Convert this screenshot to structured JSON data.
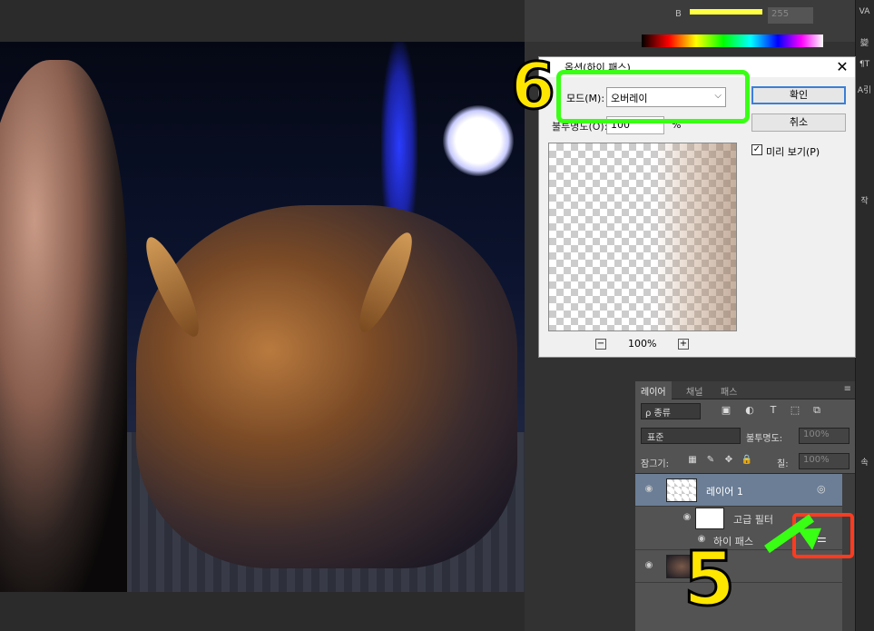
{
  "top_panel": {
    "channel_label": "B",
    "channel_value": "255"
  },
  "far_right": {
    "items": [
      "VA",
      "變",
      "¶T",
      "A引",
      "작",
      "속"
    ]
  },
  "dialog": {
    "title": "옵션(하이 패스)",
    "close_glyph": "✕",
    "mode_label": "모드(M):",
    "mode_value": "오버레이",
    "opacity_label": "불투명도(O):",
    "opacity_value": "100",
    "opacity_unit": "%",
    "ok_label": "확인",
    "cancel_label": "취소",
    "preview_label": "미리 보기(P)",
    "preview_checked": true,
    "zoom_value": "100%",
    "zoom_minus": "−",
    "zoom_plus": "+"
  },
  "layers_panel": {
    "tabs": [
      "레이어",
      "채널",
      "패스"
    ],
    "kind_label": "ρ 종류",
    "blend_mode": "표준",
    "opacity_label": "불투명도:",
    "opacity_value": "100%",
    "lock_label": "잠그기:",
    "fill_label": "칠:",
    "fill_value": "100%",
    "layers": [
      {
        "name": "레이어 1"
      },
      {
        "name": "고급 필터"
      },
      {
        "name": "하이 패스"
      },
      {
        "name": ""
      }
    ]
  },
  "annotations": {
    "step6": "6",
    "step5": "5"
  },
  "colors": {
    "annotation_green": "#39ff14",
    "annotation_yellow": "#ffe600",
    "annotation_red": "#ff3b1f",
    "accent_blue": "#3c7fd6"
  }
}
